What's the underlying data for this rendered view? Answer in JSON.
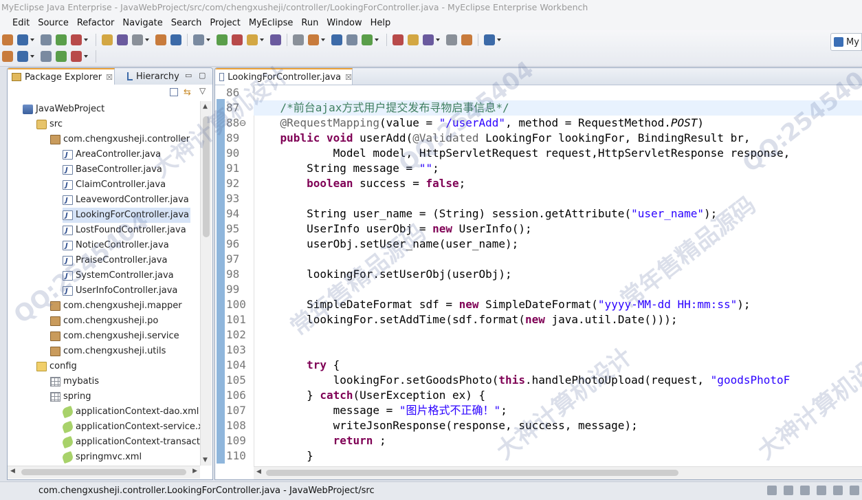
{
  "window": {
    "title": "MyEclipse Java Enterprise - JavaWebProject/src/com/chengxusheji/controller/LookingForController.java - MyEclipse Enterprise Workbench"
  },
  "menu": [
    {
      "label": "Edit"
    },
    {
      "label": "Source"
    },
    {
      "label": "Refactor"
    },
    {
      "label": "Navigate"
    },
    {
      "label": "Search"
    },
    {
      "label": "Project"
    },
    {
      "label": "MyEclipse"
    },
    {
      "label": "Run"
    },
    {
      "label": "Window"
    },
    {
      "label": "Help"
    }
  ],
  "perspective": {
    "label": "My"
  },
  "left_panel": {
    "tabs": [
      {
        "label": "Package Explorer",
        "close": "☒"
      },
      {
        "label": "Hierarchy"
      }
    ],
    "tree": [
      {
        "label": "JavaWebProject",
        "icon": "project",
        "depth": 0
      },
      {
        "label": "src",
        "icon": "src",
        "depth": 1
      },
      {
        "label": "com.chengxusheji.controller",
        "icon": "pkg",
        "depth": 2
      },
      {
        "label": "AreaController.java",
        "icon": "java",
        "depth": 3
      },
      {
        "label": "BaseController.java",
        "icon": "java",
        "depth": 3
      },
      {
        "label": "ClaimController.java",
        "icon": "java",
        "depth": 3
      },
      {
        "label": "LeavewordController.java",
        "icon": "java",
        "depth": 3
      },
      {
        "label": "LookingForController.java",
        "icon": "java",
        "depth": 3,
        "selected": true
      },
      {
        "label": "LostFoundController.java",
        "icon": "java",
        "depth": 3
      },
      {
        "label": "NoticeController.java",
        "icon": "java",
        "depth": 3
      },
      {
        "label": "PraiseController.java",
        "icon": "java",
        "depth": 3
      },
      {
        "label": "SystemController.java",
        "icon": "java",
        "depth": 3
      },
      {
        "label": "UserInfoController.java",
        "icon": "java",
        "depth": 3
      },
      {
        "label": "com.chengxusheji.mapper",
        "icon": "pkg",
        "depth": 2
      },
      {
        "label": "com.chengxusheji.po",
        "icon": "pkg",
        "depth": 2
      },
      {
        "label": "com.chengxusheji.service",
        "icon": "pkg",
        "depth": 2
      },
      {
        "label": "com.chengxusheji.utils",
        "icon": "pkg",
        "depth": 2
      },
      {
        "label": "config",
        "icon": "folder",
        "depth": 1
      },
      {
        "label": "mybatis",
        "icon": "grid",
        "depth": 2
      },
      {
        "label": "spring",
        "icon": "grid",
        "depth": 2
      },
      {
        "label": "applicationContext-dao.xml",
        "icon": "xml",
        "depth": 3
      },
      {
        "label": "applicationContext-service.xı",
        "icon": "xml",
        "depth": 3
      },
      {
        "label": "applicationContext-transacti",
        "icon": "xml",
        "depth": 3
      },
      {
        "label": "springmvc.xml",
        "icon": "xml",
        "depth": 3
      }
    ]
  },
  "editor": {
    "tab_label": "LookingForController.java",
    "tab_close": "☒",
    "lines": [
      {
        "n": "86",
        "parts": []
      },
      {
        "n": "87",
        "hl": true,
        "parts": [
          {
            "t": "    /*前台ajax方式用户提交发布寻物启事信息*/",
            "c": "cm"
          }
        ]
      },
      {
        "n": "88⊖",
        "parts": [
          {
            "t": "    @RequestMapping",
            "c": "an"
          },
          {
            "t": "(value = "
          },
          {
            "t": "\"/userAdd\"",
            "c": "str"
          },
          {
            "t": ", method = RequestMethod."
          },
          {
            "t": "POST",
            "c": "it"
          },
          {
            "t": ")"
          }
        ]
      },
      {
        "n": "89",
        "parts": [
          {
            "t": "    "
          },
          {
            "t": "public",
            "c": "kw"
          },
          {
            "t": " "
          },
          {
            "t": "void",
            "c": "kw"
          },
          {
            "t": " userAdd("
          },
          {
            "t": "@Validated",
            "c": "an"
          },
          {
            "t": " LookingFor lookingFor, BindingResult br,"
          }
        ]
      },
      {
        "n": "90",
        "parts": [
          {
            "t": "            Model model, HttpServletRequest request,HttpServletResponse response,"
          }
        ]
      },
      {
        "n": "91",
        "parts": [
          {
            "t": "        String message = "
          },
          {
            "t": "\"\"",
            "c": "str"
          },
          {
            "t": ";"
          }
        ]
      },
      {
        "n": "92",
        "parts": [
          {
            "t": "        "
          },
          {
            "t": "boolean",
            "c": "kw"
          },
          {
            "t": " success = "
          },
          {
            "t": "false",
            "c": "kw"
          },
          {
            "t": ";"
          }
        ]
      },
      {
        "n": "93",
        "parts": []
      },
      {
        "n": "94",
        "parts": [
          {
            "t": "        String user_name = (String) session.getAttribute("
          },
          {
            "t": "\"user_name\"",
            "c": "str"
          },
          {
            "t": ");"
          }
        ]
      },
      {
        "n": "95",
        "parts": [
          {
            "t": "        UserInfo userObj = "
          },
          {
            "t": "new",
            "c": "kw"
          },
          {
            "t": " UserInfo();"
          }
        ]
      },
      {
        "n": "96",
        "parts": [
          {
            "t": "        userObj.setUser_name(user_name);"
          }
        ]
      },
      {
        "n": "97",
        "parts": []
      },
      {
        "n": "98",
        "parts": [
          {
            "t": "        lookingFor.setUserObj(userObj);"
          }
        ]
      },
      {
        "n": "99",
        "parts": []
      },
      {
        "n": "100",
        "parts": [
          {
            "t": "        SimpleDateFormat sdf = "
          },
          {
            "t": "new",
            "c": "kw"
          },
          {
            "t": " SimpleDateFormat("
          },
          {
            "t": "\"yyyy-MM-dd HH:mm:ss\"",
            "c": "str"
          },
          {
            "t": ");"
          }
        ]
      },
      {
        "n": "101",
        "parts": [
          {
            "t": "        lookingFor.setAddTime(sdf.format("
          },
          {
            "t": "new",
            "c": "kw"
          },
          {
            "t": " java.util.Date()));"
          }
        ]
      },
      {
        "n": "102",
        "parts": []
      },
      {
        "n": "103",
        "parts": []
      },
      {
        "n": "104",
        "parts": [
          {
            "t": "        "
          },
          {
            "t": "try",
            "c": "kw"
          },
          {
            "t": " {"
          }
        ]
      },
      {
        "n": "105",
        "parts": [
          {
            "t": "            lookingFor.setGoodsPhoto("
          },
          {
            "t": "this",
            "c": "kw"
          },
          {
            "t": ".handlePhotoUpload(request, "
          },
          {
            "t": "\"goodsPhotoF",
            "c": "str"
          }
        ]
      },
      {
        "n": "106",
        "parts": [
          {
            "t": "        } "
          },
          {
            "t": "catch",
            "c": "kw"
          },
          {
            "t": "(UserException ex) {"
          }
        ]
      },
      {
        "n": "107",
        "parts": [
          {
            "t": "            message = "
          },
          {
            "t": "\"图片格式不正确！\"",
            "c": "str"
          },
          {
            "t": ";"
          }
        ]
      },
      {
        "n": "108",
        "parts": [
          {
            "t": "            writeJsonResponse(response, success, message);"
          }
        ]
      },
      {
        "n": "109",
        "parts": [
          {
            "t": "            "
          },
          {
            "t": "return",
            "c": "kw"
          },
          {
            "t": " ;"
          }
        ]
      },
      {
        "n": "110",
        "parts": [
          {
            "t": "        }"
          }
        ]
      }
    ]
  },
  "status": {
    "text": "com.chengxusheji.controller.LookingForController.java - JavaWebProject/src"
  },
  "watermarks": [
    "QQ:2545404",
    "大神计算机设计",
    "常年售精品源码",
    "QQ:2545404",
    "大神计算机设计",
    "常年售精品源码",
    "QQ:2545404",
    "大神计算机设计"
  ]
}
